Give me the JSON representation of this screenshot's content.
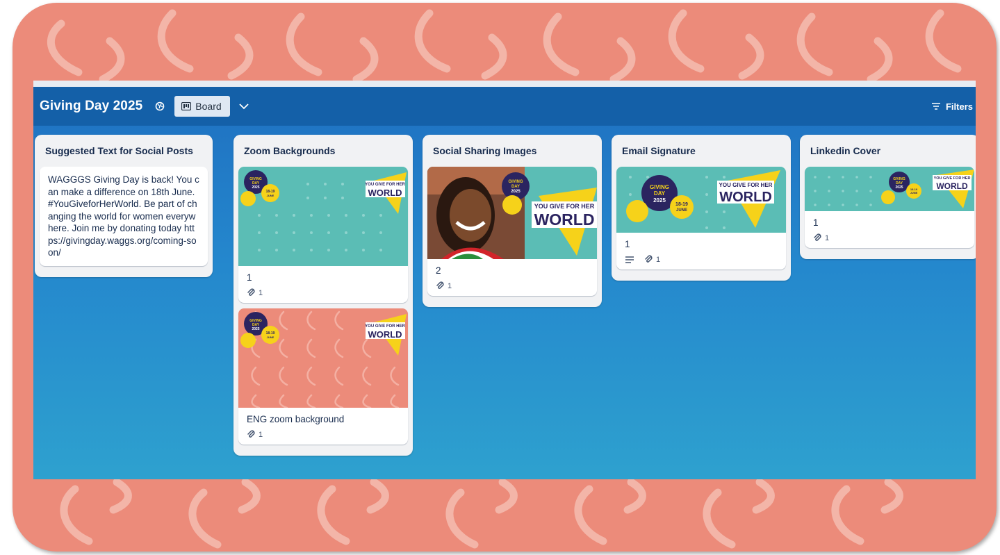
{
  "board": {
    "title": "Giving Day 2025",
    "view_label": "Board",
    "filters_label": "Filters"
  },
  "colors": {
    "frame": "#ec8b7a",
    "header": "#1460a8",
    "board_top": "#1f6fc0",
    "board_bottom": "#2ea1cf",
    "teal_cover": "#5bbdb5",
    "salmon_cover": "#ec8b7a",
    "navy_badge": "#2b2460",
    "yellow_badge": "#f6d21a"
  },
  "lists": [
    {
      "title": "Suggested Text for Social Posts",
      "cards": [
        {
          "text": "WAGGGS Giving Day is back! You can make a difference on 18th June. #YouGiveforHerWorld. Be part of changing the world for women everywhere. Join me by donating today https://givingday.waggs.org/coming-soon/"
        }
      ]
    },
    {
      "title": "Zoom Backgrounds",
      "cards": [
        {
          "text": "1",
          "attachments": "1",
          "cover": "teal"
        },
        {
          "text": "ENG zoom background",
          "attachments": "1",
          "cover": "salmon"
        }
      ]
    },
    {
      "title": "Social Sharing Images",
      "cards": [
        {
          "text": "2",
          "attachments": "1",
          "cover": "photo"
        }
      ]
    },
    {
      "title": "Email Signature",
      "cards": [
        {
          "text": "1",
          "attachments": "1",
          "cover": "teal",
          "has_description": true
        }
      ]
    },
    {
      "title": "Linkedin Cover",
      "cards": [
        {
          "text": "1",
          "attachments": "1",
          "cover": "teal"
        }
      ]
    }
  ],
  "cover_art": {
    "giving_day_badge": [
      "GIVING",
      "DAY",
      "2025"
    ],
    "date_badge": [
      "18-19",
      "JUNE"
    ],
    "slogan_small": "YOU GIVE FOR HER",
    "slogan_big": "WORLD"
  }
}
